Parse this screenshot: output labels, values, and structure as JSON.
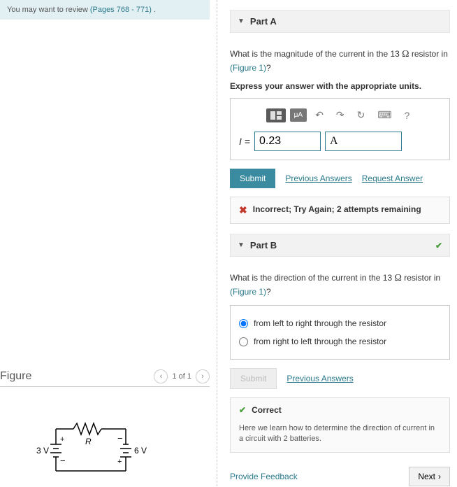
{
  "review": {
    "prefix": "You may want to review ",
    "link": "(Pages 768 - 771)",
    "suffix": " ."
  },
  "figure": {
    "title": "Figure",
    "position": "1 of 1",
    "labels": {
      "R": "R",
      "left_v": "3 V",
      "right_v": "6 V"
    }
  },
  "partA": {
    "title": "Part A",
    "question_pre": "What is the magnitude of the current in the 13 ",
    "ohm": "Ω",
    "question_post": " resistor in ",
    "figlink": "(Figure 1)",
    "qmark": "?",
    "instruction": "Express your answer with the appropriate units.",
    "toolbar": {
      "units_btn": "μA",
      "help": "?"
    },
    "input": {
      "label": "I = ",
      "value": "0.23",
      "unit": "A"
    },
    "submit": "Submit",
    "prev_ans": "Previous Answers",
    "req_ans": "Request Answer",
    "feedback": "Incorrect; Try Again; 2 attempts remaining"
  },
  "partB": {
    "title": "Part B",
    "question_pre": "What is the direction of the current in the 13 ",
    "ohm": "Ω",
    "question_post": " resistor in ",
    "figlink": "(Figure 1)",
    "qmark": "?",
    "options": [
      "from left to right through the resistor",
      "from right to left through the resistor"
    ],
    "submit": "Submit",
    "prev_ans": "Previous Answers",
    "feedback_title": "Correct",
    "feedback_sub": "Here we learn how to determine the direction of current in a circuit with 2 batteries."
  },
  "footer": {
    "feedback_link": "Provide Feedback",
    "next": "Next"
  }
}
